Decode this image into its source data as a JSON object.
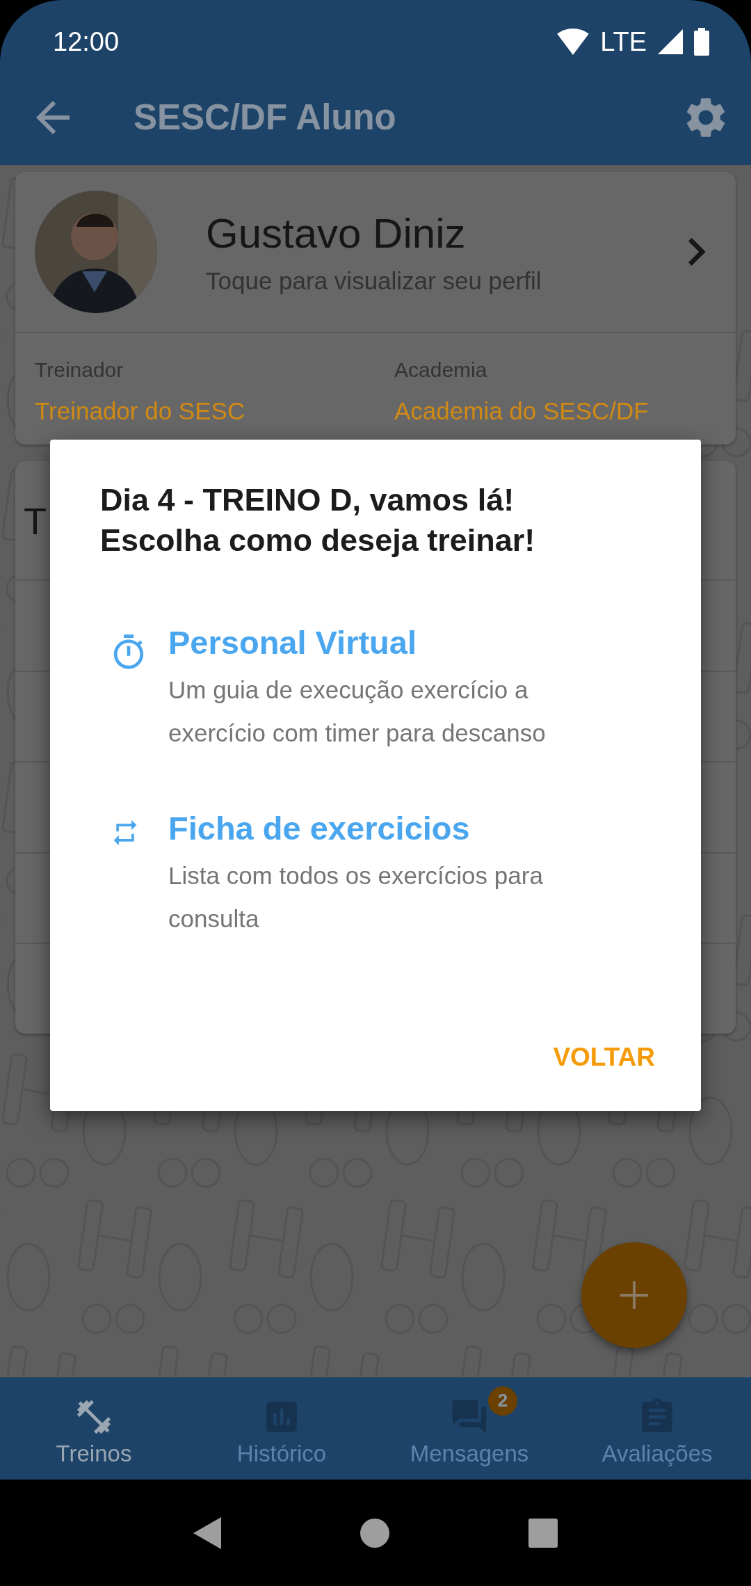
{
  "status_bar": {
    "time": "12:00",
    "network": "LTE"
  },
  "app_bar": {
    "title": "SESC/DF Aluno"
  },
  "profile": {
    "name": "Gustavo Diniz",
    "subtitle": "Toque para visualizar seu perfil",
    "fields": [
      {
        "label": "Treinador",
        "value": "Treinador do SESC"
      },
      {
        "label": "Academia",
        "value": "Academia do SESC/DF"
      }
    ]
  },
  "workouts": {
    "title": "T"
  },
  "dialog": {
    "title_lines": [
      "Dia 4 - TREINO D, vamos lá!",
      "Escolha como deseja treinar!"
    ],
    "options": [
      {
        "kind": "timer",
        "title": "Personal Virtual",
        "description": "Um guia de execução exercício a exercício com timer para descanso"
      },
      {
        "kind": "list",
        "title": "Ficha de exercicios",
        "description": "Lista com todos os exercícios para consulta"
      }
    ],
    "button": "VOLTAR"
  },
  "bottom_nav": [
    {
      "kind": "dumbbell",
      "label": "Treinos",
      "selected": true
    },
    {
      "kind": "chart",
      "label": "Histórico",
      "selected": false
    },
    {
      "kind": "chat",
      "label": "Mensagens",
      "selected": false,
      "badge": "2"
    },
    {
      "kind": "clipboard",
      "label": "Avaliações",
      "selected": false
    }
  ]
}
